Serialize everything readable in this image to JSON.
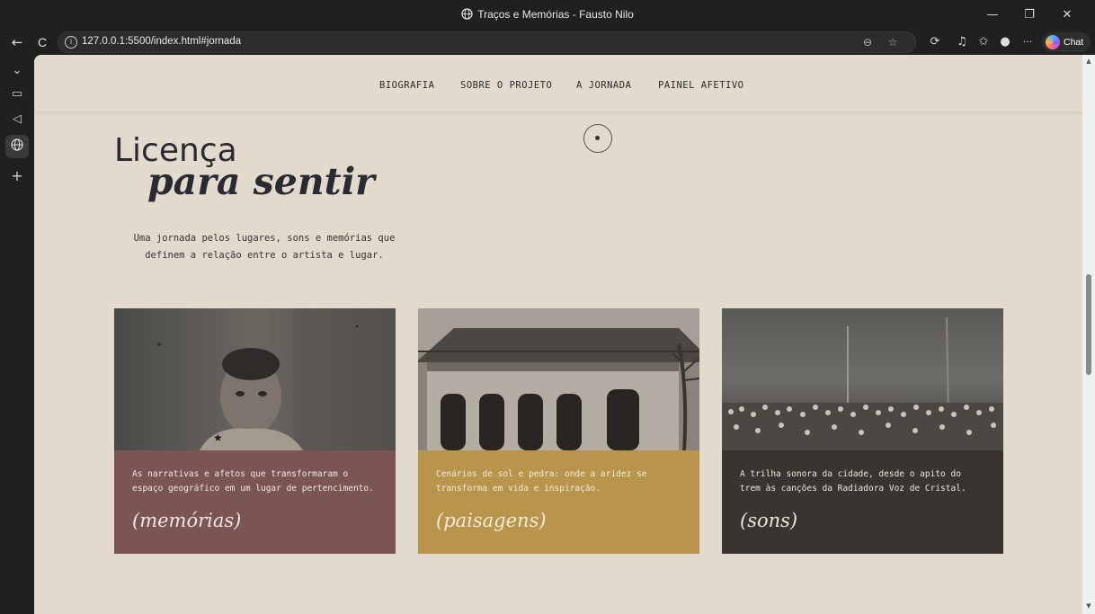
{
  "window": {
    "title": "Traços e Memórias - Fausto Nilo",
    "min_glyph": "—",
    "restore_glyph": "❐",
    "close_glyph": "✕"
  },
  "browser": {
    "back_glyph": "←",
    "refresh_glyph": "C",
    "info_glyph": "i",
    "url": "127.0.0.1:5500/index.html#jornada",
    "more_glyph": "···",
    "copilot_label": "Chat"
  },
  "sidebar": {
    "icons": [
      "chevron-down-icon",
      "tab-icon",
      "speaker-icon",
      "globe-icon",
      "plus-icon"
    ]
  },
  "site_nav": {
    "items": [
      "BIOGRAFIA",
      "SOBRE O PROJETO",
      "A JORNADA",
      "PAINEL AFETIVO"
    ]
  },
  "hero": {
    "title_line1": "Licença",
    "title_line2": "para sentir",
    "intro": "Uma jornada pelos lugares, sons e memórias que definem a relação entre o artista e lugar."
  },
  "cards": [
    {
      "text": "As narrativas e afetos que transformaram o espaço geográfico em um lugar de pertencimento.",
      "tag": "(memórias)",
      "bg": "#7a5554",
      "fg": "#f2e8e4"
    },
    {
      "text": "Cenários de sol e pedra: onde a aridez se transforma em vida e inspiração.",
      "tag": "(paisagens)",
      "bg": "#b8944d",
      "fg": "#f6ecd8"
    },
    {
      "text": "A trilha sonora da cidade, desde o apito do trem às canções da Radiadora Voz de Cristal.",
      "tag": "(sons)",
      "bg": "#3a3430",
      "fg": "#ece6de"
    }
  ],
  "colors": {
    "page_bg": "#e2dbcd",
    "heading": "#2a2a33"
  }
}
